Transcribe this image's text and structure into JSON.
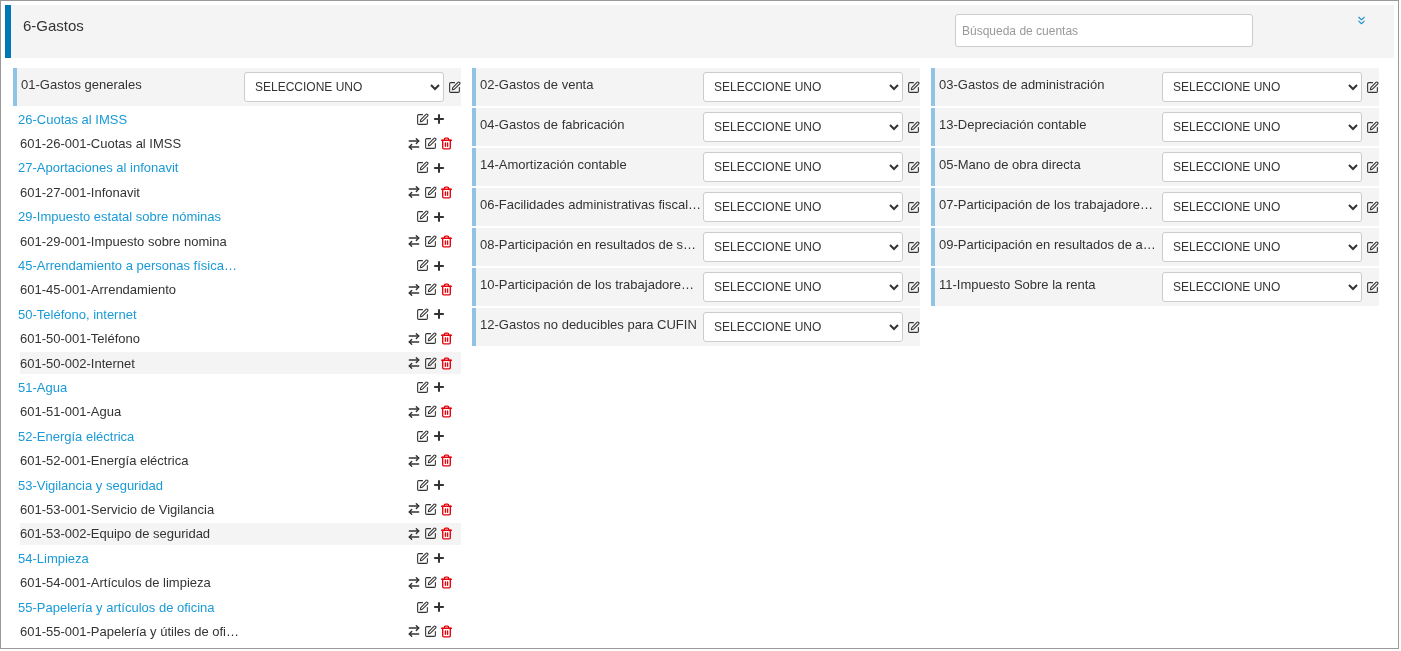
{
  "header": {
    "title": "6-Gastos",
    "search": {
      "placeholder": "Búsqueda de cuentas"
    }
  },
  "columns": [
    [
      {
        "name": "01-Gastos generales",
        "select": "SELECCIONE UNO",
        "subaccounts": [
          {
            "name": "26-Cuotas al IMSS",
            "children": [
              {
                "name": "601-26-001-Cuotas al IMSS"
              }
            ]
          },
          {
            "name": "27-Aportaciones al infonavit",
            "children": [
              {
                "name": "601-27-001-Infonavit"
              }
            ]
          },
          {
            "name": "29-Impuesto estatal sobre nóminas",
            "children": [
              {
                "name": "601-29-001-Impuesto sobre nomina"
              }
            ]
          },
          {
            "name": "45-Arrendamiento a personas física…",
            "children": [
              {
                "name": "601-45-001-Arrendamiento"
              }
            ]
          },
          {
            "name": "50-Teléfono, internet",
            "children": [
              {
                "name": "601-50-001-Teléfono"
              },
              {
                "name": "601-50-002-Internet"
              }
            ]
          },
          {
            "name": "51-Agua",
            "children": [
              {
                "name": "601-51-001-Agua"
              }
            ]
          },
          {
            "name": "52-Energía eléctrica",
            "children": [
              {
                "name": "601-52-001-Energía eléctrica"
              }
            ]
          },
          {
            "name": "53-Vigilancia y seguridad",
            "children": [
              {
                "name": "601-53-001-Servicio de Vigilancia"
              },
              {
                "name": "601-53-002-Equipo de seguridad"
              }
            ]
          },
          {
            "name": "54-Limpieza",
            "children": [
              {
                "name": "601-54-001-Artículos de limpieza"
              }
            ]
          },
          {
            "name": "55-Papelería y artículos de oficina",
            "children": [
              {
                "name": "601-55-001-Papelería y útiles de ofi…"
              }
            ]
          }
        ]
      }
    ],
    [
      {
        "name": "02-Gastos de venta",
        "select": "SELECCIONE UNO"
      },
      {
        "name": "04-Gastos de fabricación",
        "select": "SELECCIONE UNO"
      },
      {
        "name": "14-Amortización contable",
        "select": "SELECCIONE UNO"
      },
      {
        "name": "06-Facilidades administrativas fiscal…",
        "select": "SELECCIONE UNO"
      },
      {
        "name": "08-Participación en resultados de s…",
        "select": "SELECCIONE UNO"
      },
      {
        "name": "10-Participación de los trabajadore…",
        "select": "SELECCIONE UNO"
      },
      {
        "name": "12-Gastos no deducibles para CUFIN",
        "select": "SELECCIONE UNO"
      }
    ],
    [
      {
        "name": "03-Gastos de administración",
        "select": "SELECCIONE UNO"
      },
      {
        "name": "13-Depreciación contable",
        "select": "SELECCIONE UNO"
      },
      {
        "name": "05-Mano de obra directa",
        "select": "SELECCIONE UNO"
      },
      {
        "name": "07-Participación de los trabajadore…",
        "select": "SELECCIONE UNO"
      },
      {
        "name": "09-Participación en resultados de a…",
        "select": "SELECCIONE UNO"
      },
      {
        "name": "11-Impuesto Sobre la renta",
        "select": "SELECCIONE UNO"
      }
    ]
  ]
}
